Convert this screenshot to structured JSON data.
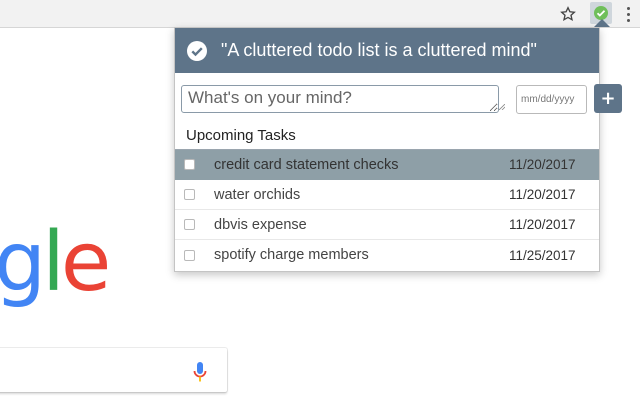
{
  "browser": {
    "icons": [
      "star-icon",
      "todo-extension-icon",
      "more-vert-icon"
    ]
  },
  "background_page": {
    "logo_fragment": [
      {
        "char": "g",
        "color": "#4285F4"
      },
      {
        "char": "l",
        "color": "#34A853"
      },
      {
        "char": "e",
        "color": "#EA4335"
      }
    ],
    "mic_icon": "microphone-icon"
  },
  "popup": {
    "header_icon": "check-circle-icon",
    "title": "\"A cluttered todo list is a cluttered mind\"",
    "task_input_placeholder": "What's on your mind?",
    "date_placeholder": "mm/dd/yyyy",
    "add_button_label": "+",
    "section_title": "Upcoming Tasks",
    "tasks": [
      {
        "text": "credit card statement checks",
        "date": "11/20/2017",
        "selected": true
      },
      {
        "text": "water orchids",
        "date": "11/20/2017",
        "selected": false
      },
      {
        "text": "dbvis expense",
        "date": "11/20/2017",
        "selected": false
      },
      {
        "text": "spotify charge members",
        "date": "11/25/2017",
        "selected": false
      }
    ],
    "colors": {
      "header": "#5e7489",
      "selected_row": "#8e9fa7"
    }
  }
}
